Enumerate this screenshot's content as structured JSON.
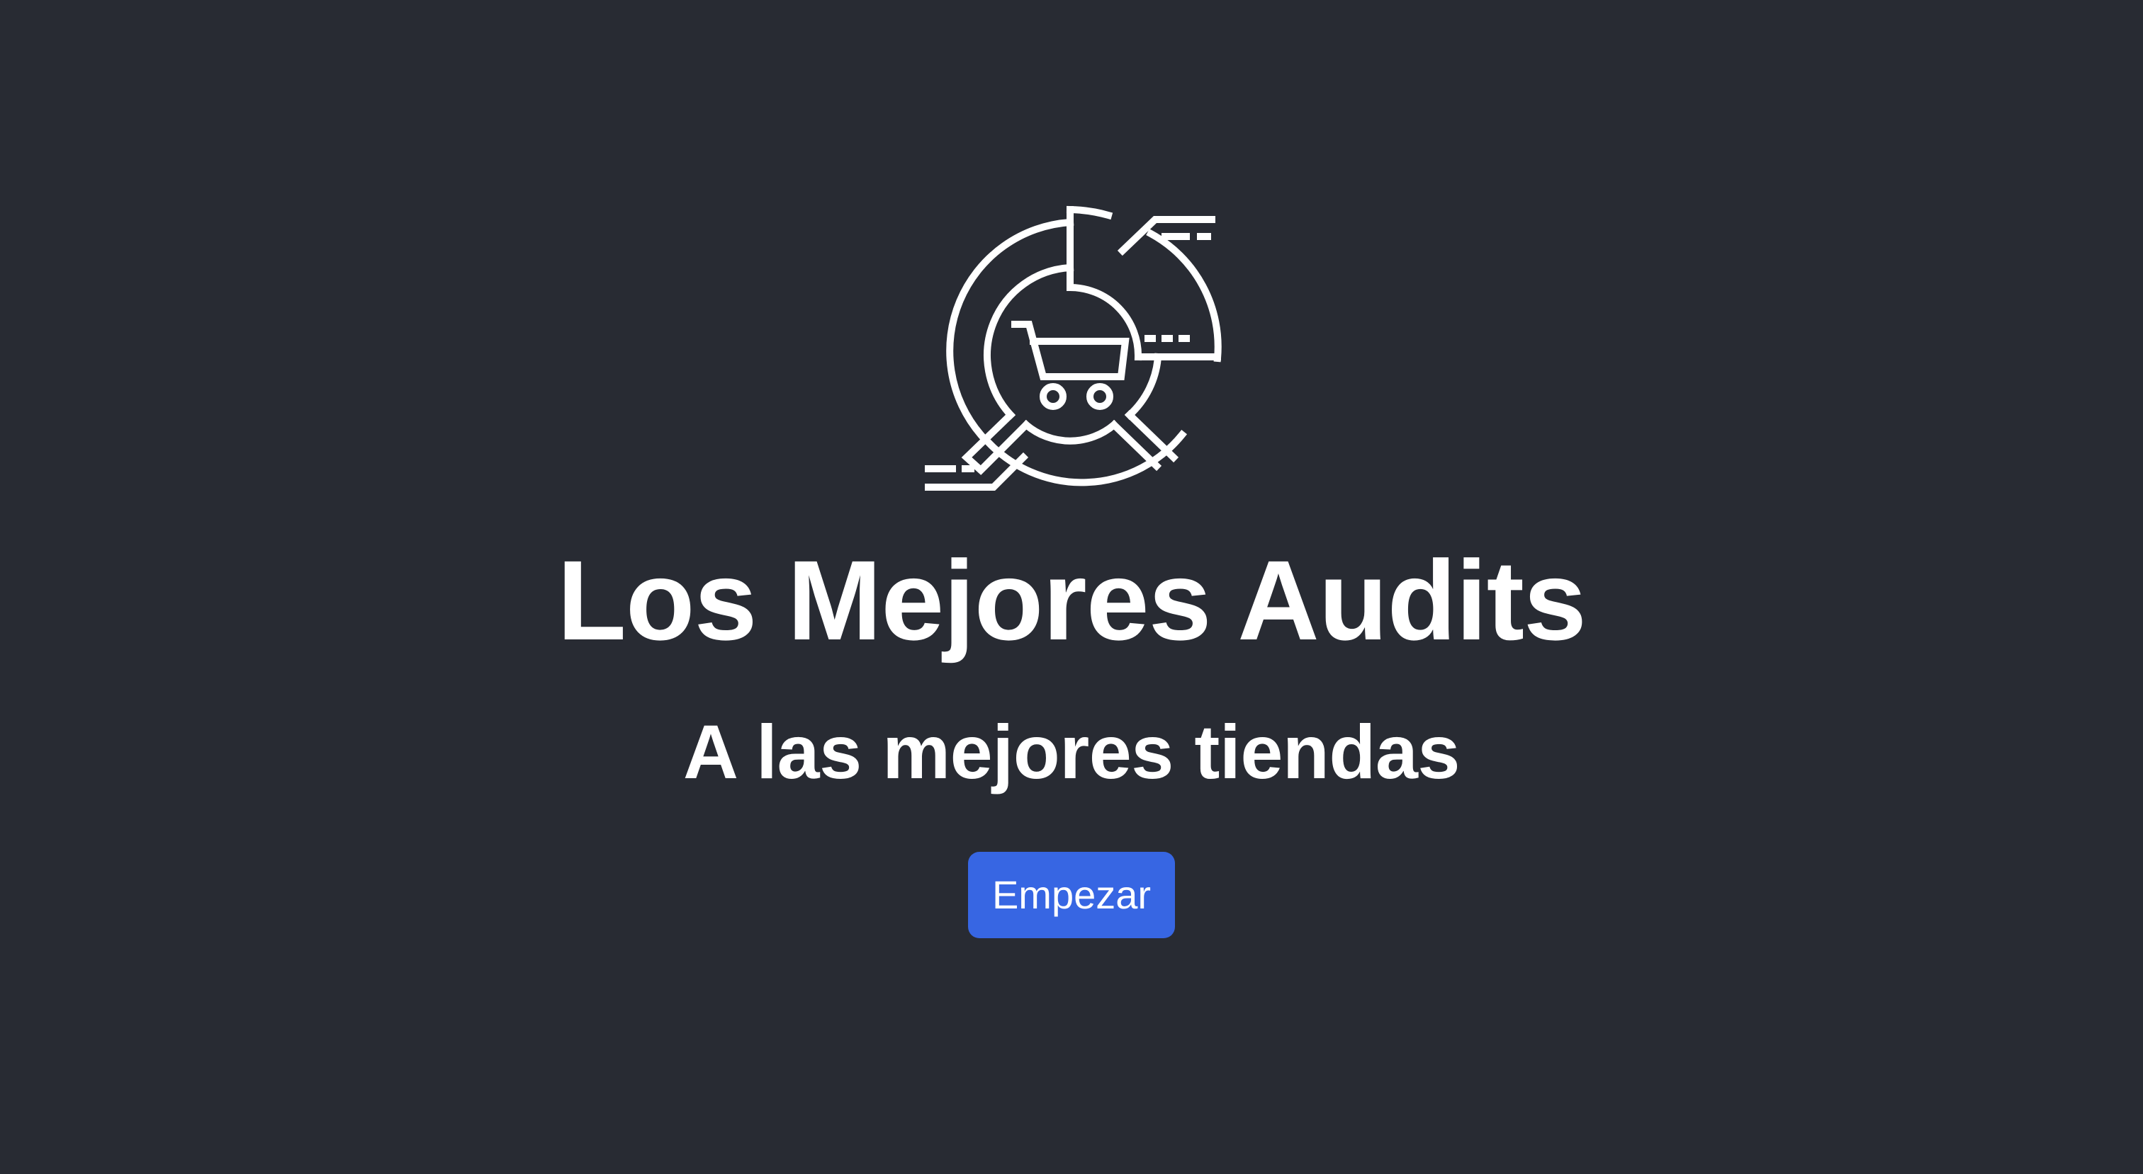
{
  "hero": {
    "logo_icon": "shopping-cart-audit-icon",
    "title": "Los Mejores Audits",
    "subtitle": "A las mejores tiendas",
    "cta_label": "Empezar"
  },
  "colors": {
    "background": "#282b33",
    "text": "#ffffff",
    "button": "#3766e3"
  }
}
